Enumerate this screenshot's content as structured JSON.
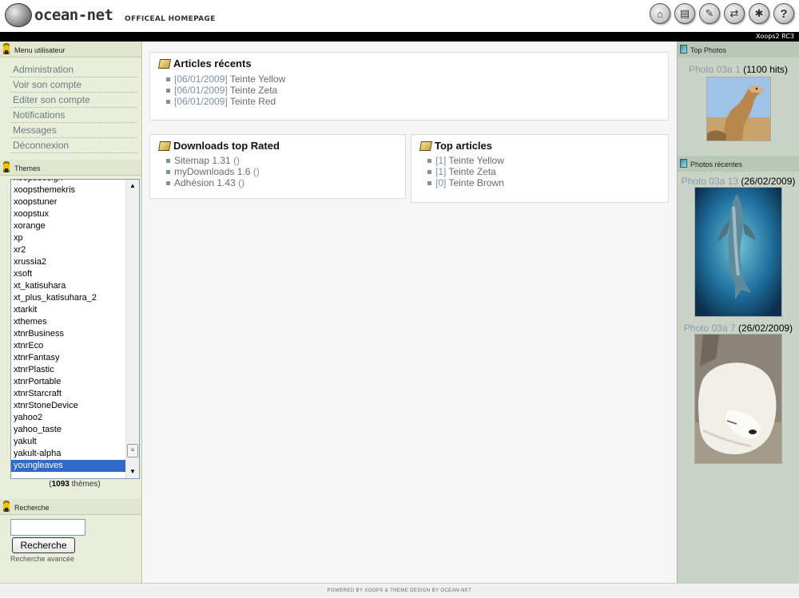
{
  "header": {
    "logo_text": "ocean-net",
    "slogan": "OFFICEAL HOMEPAGE",
    "version": "Xoops2 RC3",
    "icons": [
      "home-icon",
      "news-icon",
      "tools-icon",
      "sync-icon",
      "settings-icon",
      "help-icon"
    ]
  },
  "usermenu": {
    "title": "Menu utilisateur",
    "items": [
      "Administration",
      "Voir son compte",
      "Editer son compte",
      "Notifications",
      "Messages",
      "Déconnexion"
    ]
  },
  "themes": {
    "title": "Themes",
    "items": [
      "xoopsdesign",
      "xoopsthemekris",
      "xoopstuner",
      "xoopstux",
      "xorange",
      "xp",
      "xr2",
      "xrussia2",
      "xsoft",
      "xt_katisuhara",
      "xt_plus_katisuhara_2",
      "xtarkit",
      "xthemes",
      "xtnrBusiness",
      "xtnrEco",
      "xtnrFantasy",
      "xtnrPlastic",
      "xtnrPortable",
      "xtnrStarcraft",
      "xtnrStoneDevice",
      "yahoo2",
      "yahoo_taste",
      "yakult",
      "yakult-alpha",
      "youngleaves"
    ],
    "selected": "youngleaves",
    "count": "1093",
    "count_suffix": "thèmes"
  },
  "search": {
    "title": "Recherche",
    "button": "Recherche",
    "advanced": "Recherche avancée"
  },
  "recent_articles": {
    "title": "Articles récents",
    "items": [
      {
        "date": "[06/01/2009]",
        "title": "Teinte Yellow"
      },
      {
        "date": "[06/01/2009]",
        "title": "Teinte Zeta"
      },
      {
        "date": "[06/01/2009]",
        "title": "Teinte Red"
      }
    ]
  },
  "downloads": {
    "title": "Downloads top Rated",
    "items": [
      {
        "name": "Sitemap 1.31",
        "extra": "()"
      },
      {
        "name": "myDownloads 1.6",
        "extra": "()"
      },
      {
        "name": "Adhésion 1.43",
        "extra": "()"
      }
    ]
  },
  "top_articles": {
    "title": "Top articles",
    "items": [
      {
        "count": "[1]",
        "title": "Teinte Yellow"
      },
      {
        "count": "[1]",
        "title": "Teinte Zeta"
      },
      {
        "count": "[0]",
        "title": "Teinte Brown"
      }
    ]
  },
  "top_photos": {
    "title": "Top Photos",
    "photo": {
      "name": "Photo 03a 1",
      "hits": "(1100 hits)",
      "subject": "camel"
    }
  },
  "recent_photos": {
    "title": "Photos récentes",
    "photos": [
      {
        "name": "Photo 03a 13",
        "date": "(26/02/2009)",
        "subject": "dolphin"
      },
      {
        "name": "Photo 03a 7",
        "date": "(26/02/2009)",
        "subject": "polar-bear"
      }
    ]
  },
  "footer": "POWERED BY XOOPS & THEME DESIGN BY OCEAN-NET"
}
